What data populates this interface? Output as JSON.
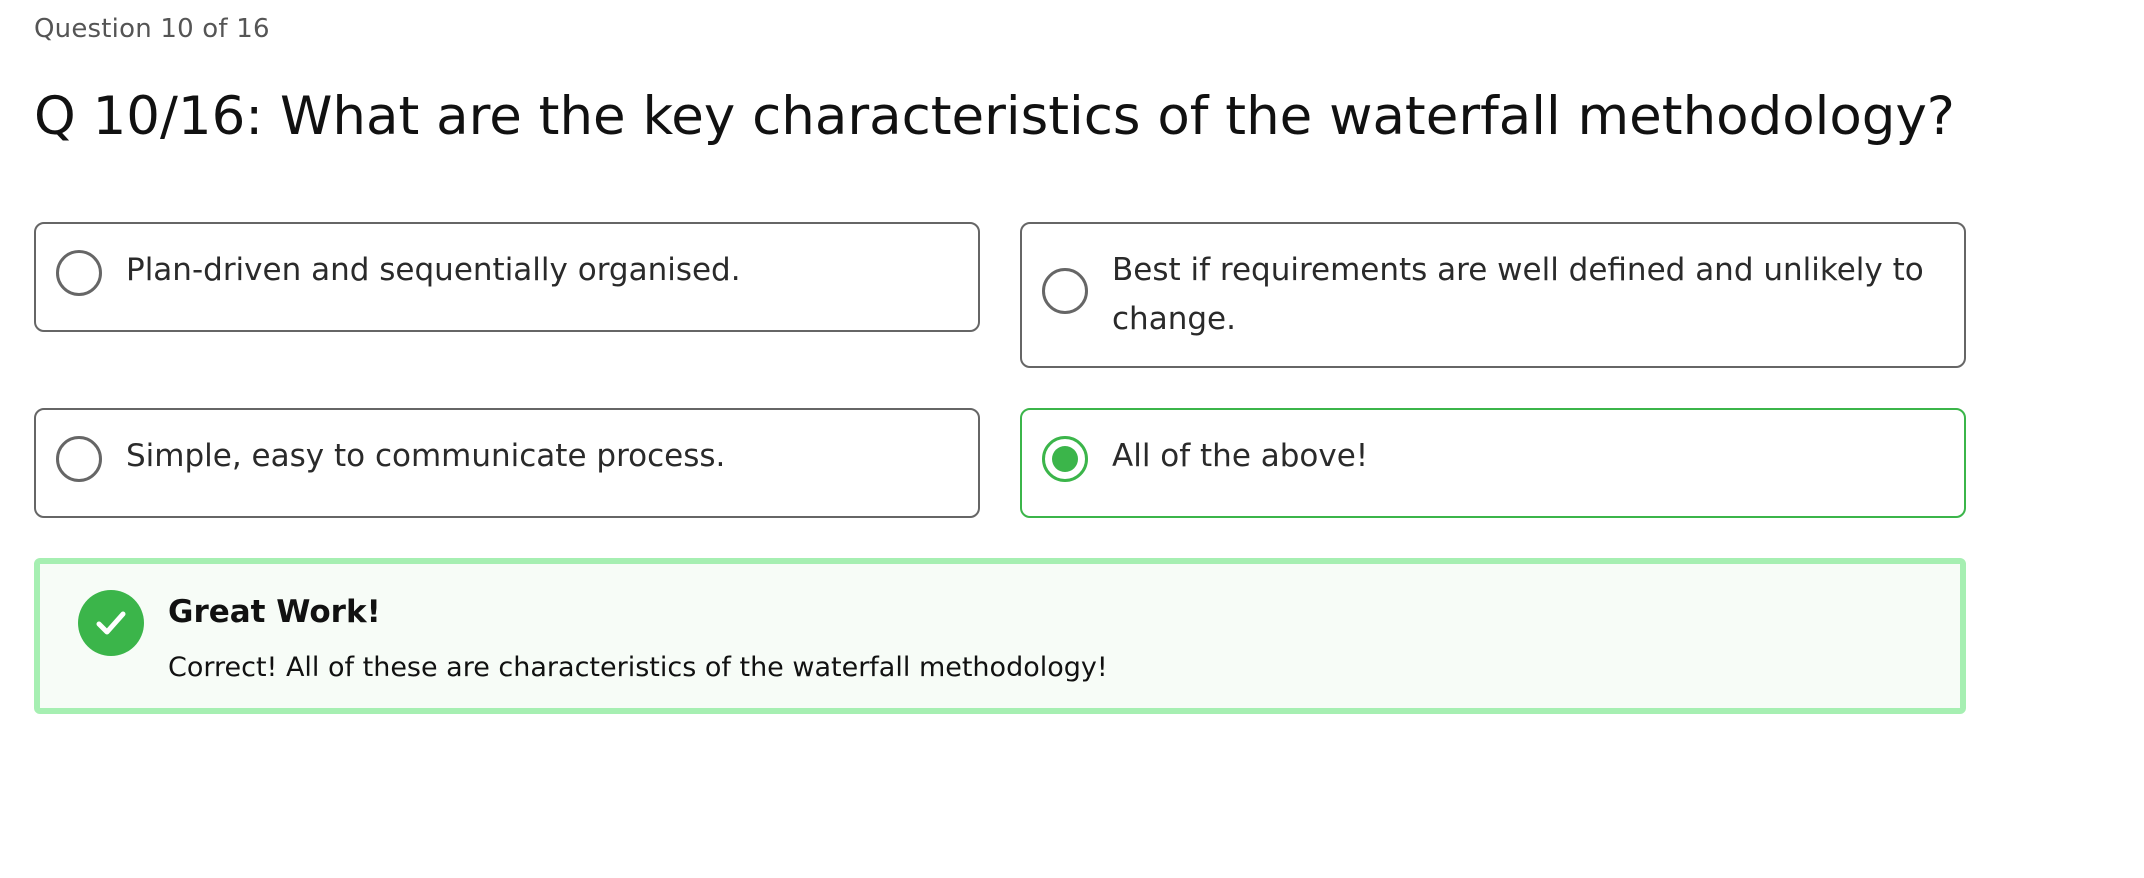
{
  "progress_text": "Question 10 of 16",
  "question_text": "Q 10/16: What are the key characteristics of the waterfall methodology?",
  "answers": [
    {
      "label": "Plan-driven and sequentially organised.",
      "selected": false
    },
    {
      "label": "Best if requirements are well defined and unlikely to change.",
      "selected": false
    },
    {
      "label": "Simple, easy to communicate process.",
      "selected": false
    },
    {
      "label": "All of the above!",
      "selected": true
    }
  ],
  "feedback": {
    "title": "Great Work!",
    "message": "Correct! All of these are characteristics of the waterfall methodology!",
    "icon": "check-icon"
  },
  "colors": {
    "correct": "#3bb54a",
    "feedback_border": "#a6efb2",
    "feedback_background": "#f7fcf7",
    "option_border": "#666666"
  }
}
